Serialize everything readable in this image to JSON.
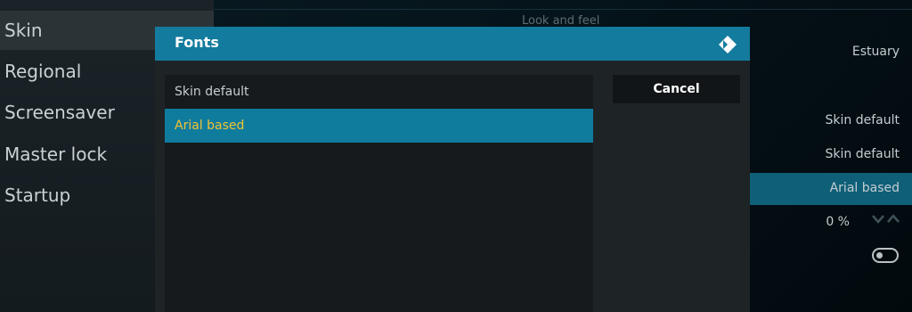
{
  "sidebar": {
    "items": [
      {
        "label": "Skin"
      },
      {
        "label": "Regional"
      },
      {
        "label": "Screensaver"
      },
      {
        "label": "Master lock"
      },
      {
        "label": "Startup"
      }
    ],
    "selected": "Skin"
  },
  "settings": {
    "section_header": "Look and feel",
    "values": {
      "skin": "Estuary",
      "theme": "Skin default",
      "colours": "Skin default",
      "fonts": "Arial based",
      "zoom": "0 %"
    }
  },
  "dialog": {
    "title": "Fonts",
    "options": [
      {
        "label": "Skin default"
      },
      {
        "label": "Arial based"
      }
    ],
    "focused_option": "Arial based",
    "cancel_label": "Cancel"
  },
  "colors": {
    "accent": "#137b9d",
    "focus_text": "#f1c232"
  }
}
